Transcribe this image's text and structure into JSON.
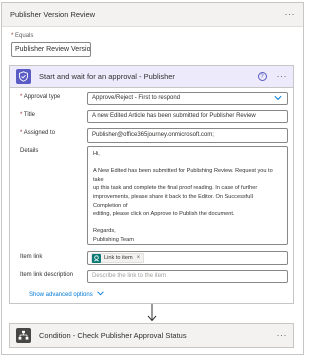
{
  "case": {
    "title": "Publisher Version Review",
    "more_label": "···",
    "equals_label": "Equals",
    "equals_required_mark": "*",
    "equals_value": "Publisher Review Version"
  },
  "action": {
    "title": "Start and wait for an approval - Publisher",
    "help_glyph": "?",
    "more_label": "···",
    "icon_color": "#5a5cc4",
    "fields": {
      "approval_type": {
        "required": "*",
        "label": "Approval type",
        "value": "Approve/Reject - First to respond"
      },
      "title": {
        "required": "*",
        "label": "Title",
        "value": "A new Edited Article has been submitted for Publisher Review"
      },
      "assigned_to": {
        "required": "*",
        "label": "Assigned to",
        "value": "Publisher@office365journey.onmicrosoft.com;"
      },
      "details": {
        "label": "Details",
        "lines": [
          "Hi,",
          "",
          "A New Edited has been submitted for Publishing Review. Request you to take",
          "up this task and complete the final proof reading. In case of further",
          "improvements, please share it back to the Editor. On Successfull Completion of",
          "editing, please click on Approve to Publish the document.",
          "",
          "Regards,",
          "Publishing Team"
        ]
      },
      "item_link": {
        "label": "Item link",
        "chip_label": "Link to item",
        "chip_remove": "×"
      },
      "item_link_description": {
        "label": "Item link description",
        "placeholder": "Describe the link to the item"
      }
    },
    "advanced_label": "Show advanced options"
  },
  "next_step": {
    "title": "Condition - Check Publisher Approval Status",
    "more_label": "···",
    "icon_color": "#484644"
  },
  "accent_color": "#0078d4"
}
